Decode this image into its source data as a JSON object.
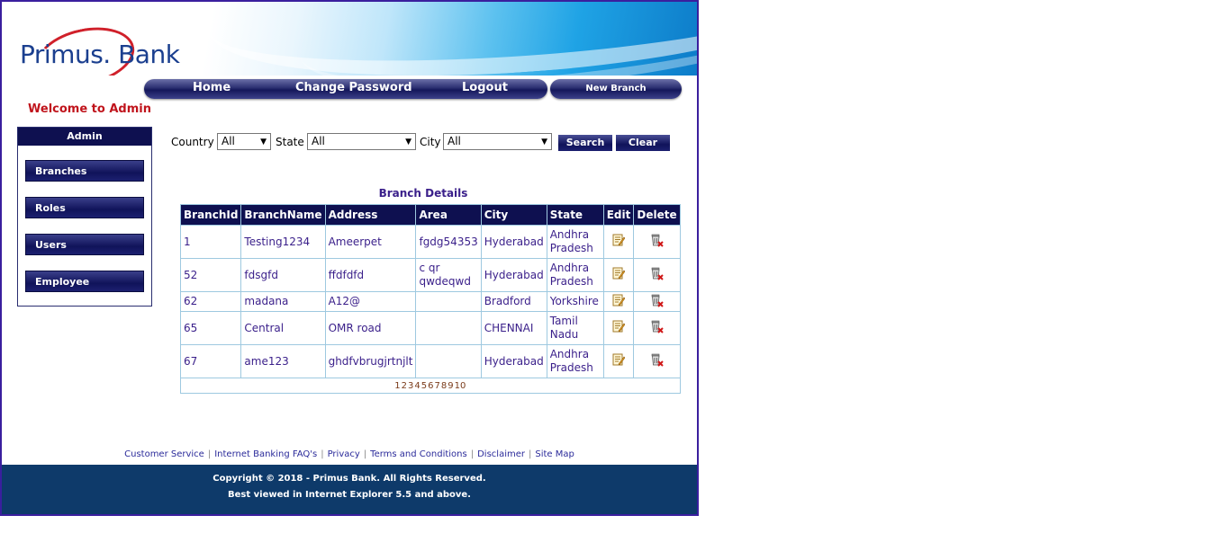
{
  "brand": {
    "logo_text": "Primus. Bank"
  },
  "nav": {
    "items": [
      "Home",
      "Change Password",
      "Logout"
    ],
    "new_branch": "New Branch"
  },
  "welcome": "Welcome to Admin",
  "sidebar": {
    "title": "Admin",
    "items": [
      "Branches",
      "Roles",
      "Users",
      "Employee"
    ]
  },
  "filters": {
    "country_label": "Country",
    "country_value": "All",
    "state_label": "State",
    "state_value": "All",
    "city_label": "City",
    "city_value": "All",
    "search_label": "Search",
    "clear_label": "Clear"
  },
  "table": {
    "title": "Branch Details",
    "headers": [
      "BranchId",
      "BranchName",
      "Address",
      "Area",
      "City",
      "State",
      "Edit",
      "Delete"
    ],
    "rows": [
      [
        "1",
        "Testing1234",
        "Ameerpet",
        "fgdg54353",
        "Hyderabad",
        "Andhra Pradesh"
      ],
      [
        "52",
        "fdsgfd",
        "ffdfdfd",
        "c qr qwdeqwd",
        "Hyderabad",
        "Andhra Pradesh"
      ],
      [
        "62",
        "madana",
        "A12@",
        "",
        "Bradford",
        "Yorkshire"
      ],
      [
        "65",
        "Central",
        "OMR road",
        "",
        "CHENNAI",
        "Tamil Nadu"
      ],
      [
        "67",
        "ame123",
        "ghdfvbrugjrtnjlt",
        "",
        "Hyderabad",
        "Andhra Pradesh"
      ]
    ],
    "pages": [
      "1",
      "2",
      "3",
      "4",
      "5",
      "6",
      "7",
      "8",
      "9",
      "10"
    ]
  },
  "footer_links": [
    "Customer Service",
    "Internet Banking FAQ's",
    "Privacy",
    "Terms and Conditions",
    "Disclaimer",
    "Site Map"
  ],
  "footer": {
    "copyright": "Copyright © 2018 - Primus Bank. All Rights Reserved.",
    "note": "Best viewed in Internet Explorer 5.5 and above."
  },
  "colors": {
    "navy": "#0e1050",
    "red": "#c0141c",
    "footer_bg": "#0e3a6a",
    "link": "#3a1f8a"
  },
  "icons": {
    "edit": "edit-icon",
    "delete": "delete-icon",
    "dropdown": "chevron-down-icon"
  }
}
